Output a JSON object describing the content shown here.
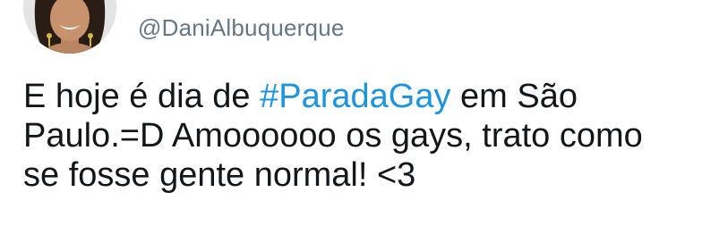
{
  "user": {
    "handle": "@DaniAlbuquerque",
    "avatar_icon": "profile-photo"
  },
  "tweet": {
    "text_before": "E hoje é dia de ",
    "hashtag": "#ParadaGay",
    "text_after": " em São Paulo.=D Amoooooo os gays, trato como se fosse gente normal! <3"
  },
  "colors": {
    "hashtag": "#1b95e0",
    "handle": "#657786",
    "text": "#14171a"
  }
}
